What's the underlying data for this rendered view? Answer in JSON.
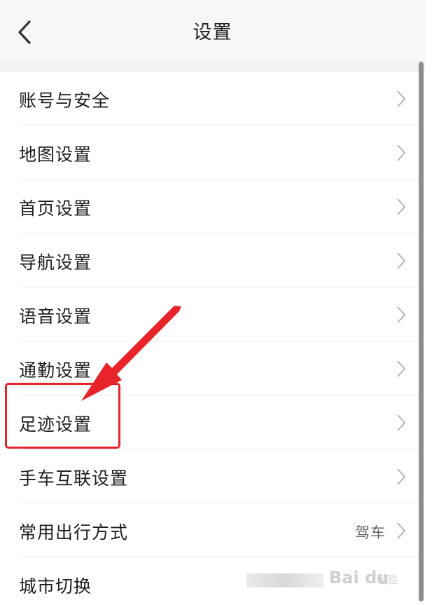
{
  "header": {
    "title": "设置",
    "back_icon": "chevron-left-icon"
  },
  "settings": {
    "items": [
      {
        "label": "账号与安全",
        "value": ""
      },
      {
        "label": "地图设置",
        "value": ""
      },
      {
        "label": "首页设置",
        "value": ""
      },
      {
        "label": "导航设置",
        "value": ""
      },
      {
        "label": "语音设置",
        "value": ""
      },
      {
        "label": "通勤设置",
        "value": ""
      },
      {
        "label": "足迹设置",
        "value": ""
      },
      {
        "label": "手车互联设置",
        "value": ""
      },
      {
        "label": "常用出行方式",
        "value": "驾车"
      },
      {
        "label": "城市切换",
        "value": ""
      }
    ]
  },
  "annotation": {
    "color": "#e8232a",
    "highlighted_item": "足迹设置"
  },
  "watermark": {
    "brand": "Bai du",
    "sub": "经验"
  },
  "colors": {
    "header_bg": "#f7f7f7",
    "text": "#1e1e1e",
    "chevron": "#b5b5b5"
  }
}
